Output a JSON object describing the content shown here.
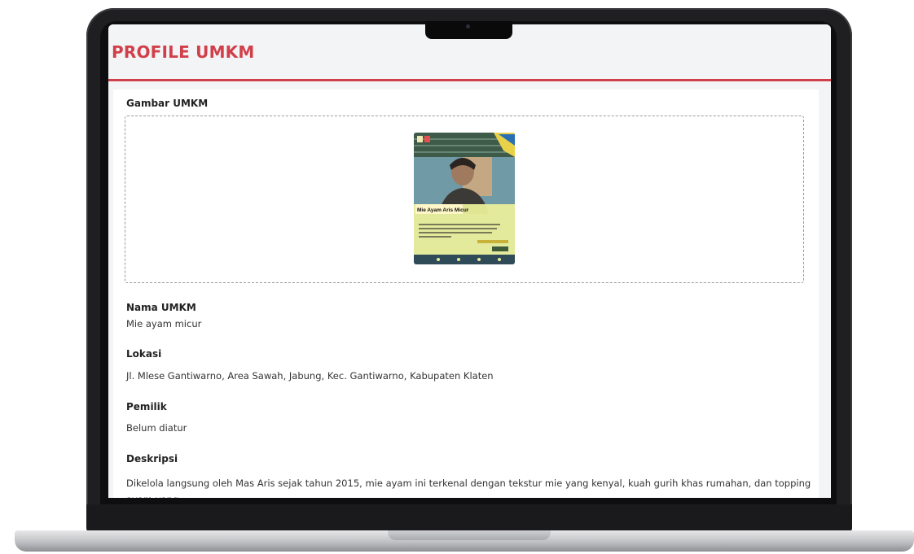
{
  "app": {
    "title": "PROFILE UMKM"
  },
  "theme": {
    "accent": "#d1404a",
    "background": "#f3f4f5",
    "card": "#ffffff"
  },
  "gambar": {
    "label": "Gambar UMKM",
    "poster_title": "Mie Ayam Aris Micur"
  },
  "fields": {
    "nama": {
      "label": "Nama UMKM",
      "value": "Mie ayam micur"
    },
    "lokasi": {
      "label": "Lokasi",
      "value": "Jl. Mlese Gantiwarno, Area Sawah, Jabung, Kec. Gantiwarno, Kabupaten Klaten"
    },
    "pemilik": {
      "label": "Pemilik",
      "value": "Belum diatur"
    },
    "deskripsi": {
      "label": "Deskripsi",
      "value": "Dikelola langsung oleh Mas Aris sejak tahun 2015, mie ayam ini terkenal dengan tekstur mie yang kenyal, kuah gurih khas rumahan, dan topping ayam yang"
    }
  }
}
